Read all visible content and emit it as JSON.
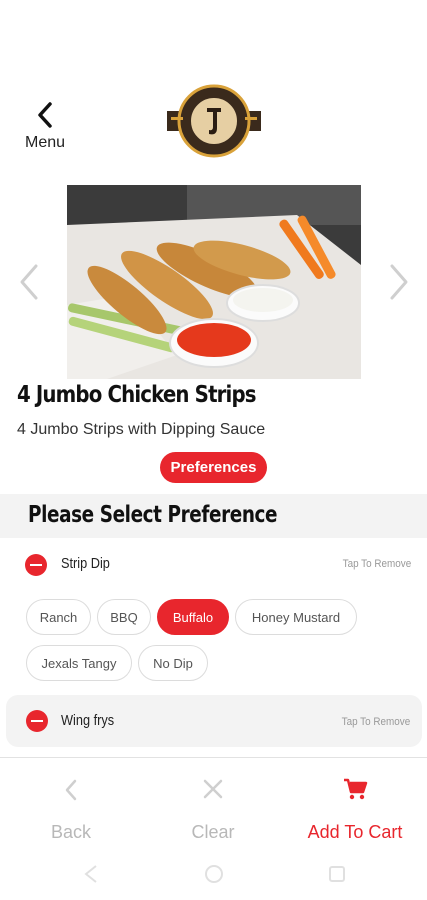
{
  "header": {
    "back_label": "Menu"
  },
  "item": {
    "title": "4 Jumbo Chicken Strips",
    "description": "4  Jumbo Strips with Dipping Sauce",
    "preferences_button": "Preferences"
  },
  "preferences": {
    "section_title": "Please Select Preference",
    "groups": [
      {
        "name": "Strip Dip",
        "remove_label": "Tap To Remove",
        "options": [
          {
            "label": "Ranch",
            "selected": false
          },
          {
            "label": "BBQ",
            "selected": false
          },
          {
            "label": "Buffalo",
            "selected": true
          },
          {
            "label": "Honey Mustard",
            "selected": false
          },
          {
            "label": "Jexals Tangy",
            "selected": false
          },
          {
            "label": "No Dip",
            "selected": false
          }
        ]
      },
      {
        "name": "Wing frys",
        "remove_label": "Tap To Remove"
      }
    ]
  },
  "actions": {
    "back": "Back",
    "clear": "Clear",
    "add_to_cart": "Add To Cart"
  },
  "icons": {
    "back": "chevron-left-icon",
    "prev": "chevron-left-icon",
    "next": "chevron-right-icon",
    "clear": "close-icon",
    "cart": "cart-icon"
  },
  "colors": {
    "accent": "#e8262d",
    "header_bg": "#f3f3f3",
    "muted": "#b8b8b8"
  }
}
